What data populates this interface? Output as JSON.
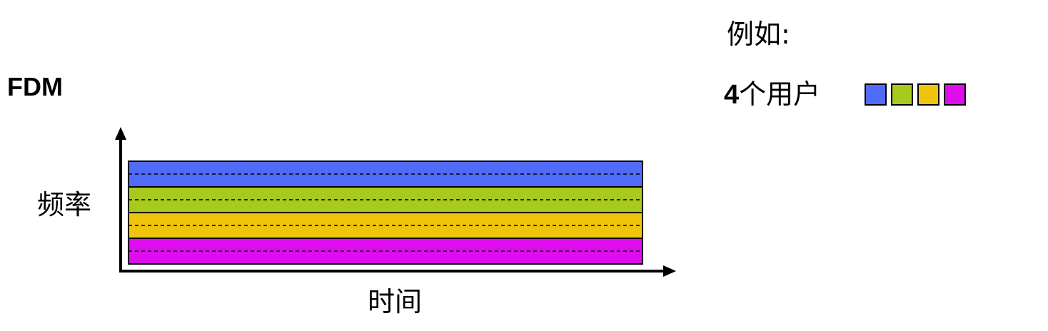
{
  "title": "FDM",
  "example": {
    "label": "例如:",
    "user_count_number": "4",
    "user_count_text": "个用户"
  },
  "users": [
    {
      "name": "user-1",
      "color": "#4f6bf8"
    },
    {
      "name": "user-2",
      "color": "#a8c91e"
    },
    {
      "name": "user-3",
      "color": "#efc40d"
    },
    {
      "name": "user-4",
      "color": "#dd0ded"
    }
  ],
  "chart": {
    "y_axis_label": "频率",
    "x_axis_label": "时间",
    "band_line_style": "dashed",
    "band_divider_color": "#000000"
  }
}
